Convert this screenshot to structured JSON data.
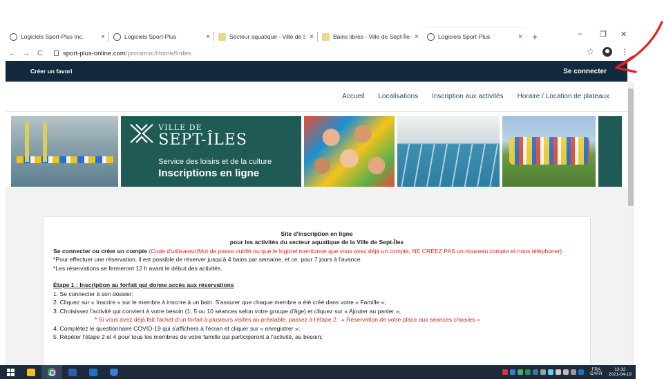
{
  "browser": {
    "tabs": [
      {
        "title": "Logiciels Sport-Plus Inc.",
        "close": "×"
      },
      {
        "title": "Logiciels Sport-Plus",
        "close": "×"
      },
      {
        "title": "Secteur aquatique - Ville de Se",
        "close": "×"
      },
      {
        "title": "Bains libres - Ville de Sept-Îles",
        "close": "×"
      },
      {
        "title": "Logiciels Sport-Plus",
        "close": "×"
      }
    ],
    "new_tab": "+",
    "window_controls": {
      "minimize": "–",
      "restore": "❐",
      "close": "✕"
    },
    "nav": {
      "back": "←",
      "forward": "→",
      "reload": "C"
    },
    "url_host": "sport-plus-online.com",
    "url_path": "/prmsmvc/Home/Index",
    "bookmark_star": "☆",
    "menu": "⋮"
  },
  "site": {
    "topbar": {
      "favorite": "Créer un favori",
      "login": "Se connecter"
    },
    "nav": [
      "Accueil",
      "Localisations",
      "Inscription aux activités",
      "Horaire / Location de plateaux"
    ],
    "banner": {
      "ville_de": "VILLE DE",
      "city": "SEPT-ÎLES",
      "service": "Service des loisirs et de la culture",
      "inscriptions": "Inscriptions en ligne"
    },
    "content": {
      "title1": "Site d'inscription en ligne",
      "title2": "pour les activités du secteur aquatique de la Ville de Sept-Îles",
      "login_bold": "Se connecter ou créer un compte",
      "login_red": " (Code d'utilisateur/Mot de passe oublié ou que le logiciel mentionne que vous avez déjà un compte, NE CRÉEZ PAS un nouveau compte et nous téléphoner)",
      "note1": "*Pour effectuer une réservation, il est possible de réserver jusqu'à 4 bains par semaine, et ce, pour 7 jours à l'avance.",
      "note2": "*Les réservations se fermeront 12 h avant le début des activités.",
      "step1_title": "Étape 1 : Inscription au forfait qui donne accès aux réservations",
      "steps": [
        "1. Se connecter à son dossier;",
        "2. Cliquez sur « Inscrire » sur le membre à inscrire à un bain. S'assurer que chaque membre a été créé dans votre « Famille »;",
        "3. Choisissez l'activité qui convient à votre besoin (1, 5 ou 10 séances selon votre groupe d'âge) et cliquez sur « Ajouter au panier »;"
      ],
      "red_note": "* Si vous avez déjà fait l'achat d'un forfait à plusieurs visites au préalable, passez à l'étape 2 : « Réservation de votre place aux séances choisies »",
      "step4": "4. Complétez le questionnaire COVID-19 qui s'affichera à l'écran et cliquer sur « enregistrer »;",
      "step5_partial": "5. Répéter l'étape 2 et 4 pour tous les membres de votre famille qui participeront à l'activité, au besoin;"
    }
  },
  "taskbar": {
    "lang": "FRA",
    "lang2": "CAFR",
    "time": "13:32",
    "date": "2021-04-19"
  },
  "colors": {
    "topbar": "#13293d",
    "brand": "#1f5a54",
    "nav_link": "#2a4e6e",
    "red_text": "#e3261b",
    "annotation_arrow": "#e0201b"
  }
}
